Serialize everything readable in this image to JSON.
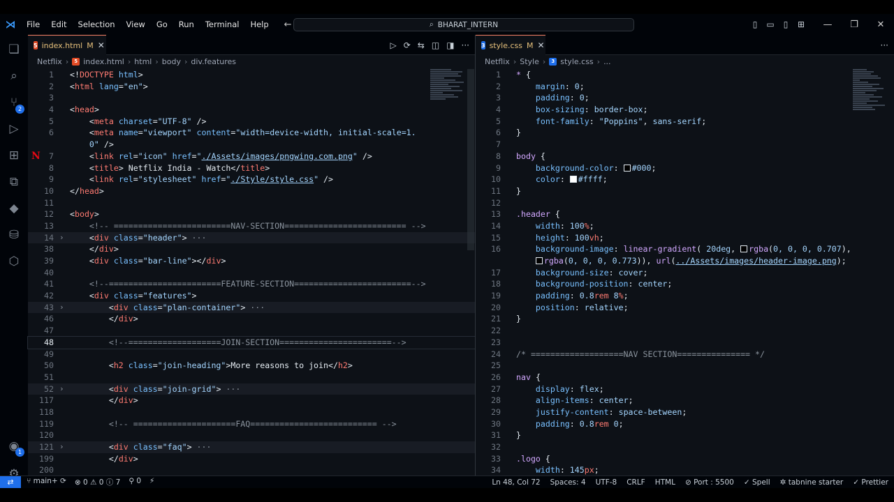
{
  "titlebar": {
    "menu": [
      "File",
      "Edit",
      "Selection",
      "View",
      "Go",
      "Run",
      "Terminal",
      "Help"
    ],
    "search": "BHARAT_INTERN"
  },
  "activity": {
    "source_control_badge": "2",
    "accounts_badge": "1"
  },
  "left": {
    "tab": {
      "name": "index.html",
      "modified": "M"
    },
    "crumbs": [
      "Netflix",
      "index.html",
      "html",
      "body",
      "div.features"
    ],
    "lines": [
      {
        "n": "1",
        "h": "<span class='p'>&lt;!</span><span class='t'>DOCTYPE</span> <span class='a'>html</span><span class='p'>&gt;</span>"
      },
      {
        "n": "2",
        "h": "<span class='p'>&lt;</span><span class='t'>html</span> <span class='a'>lang</span><span class='p'>=</span><span class='s'>\"en\"</span><span class='p'>&gt;</span>"
      },
      {
        "n": "3",
        "h": ""
      },
      {
        "n": "4",
        "h": "<span class='p'>&lt;</span><span class='t'>head</span><span class='p'>&gt;</span>"
      },
      {
        "n": "5",
        "h": "    <span class='p'>&lt;</span><span class='t'>meta</span> <span class='a'>charset</span><span class='p'>=</span><span class='s'>\"UTF-8\"</span> <span class='p'>/&gt;</span>"
      },
      {
        "n": "6",
        "h": "    <span class='p'>&lt;</span><span class='t'>meta</span> <span class='a'>name</span><span class='p'>=</span><span class='s'>\"viewport\"</span> <span class='a'>content</span><span class='p'>=</span><span class='s'>\"width=device-width, initial-scale=1.</span>"
      },
      {
        "n": "",
        "h": "    <span class='s'>0\"</span> <span class='p'>/&gt;</span>"
      },
      {
        "n": "7",
        "h": "    <span class='p'>&lt;</span><span class='t'>link</span> <span class='a'>rel</span><span class='p'>=</span><span class='s'>\"icon\"</span> <span class='a'>href</span><span class='p'>=</span><span class='s'>\"<u>./Assets/images/pngwing.com.png</u>\"</span> <span class='p'>/&gt;</span>",
        "logo": "N"
      },
      {
        "n": "8",
        "h": "    <span class='p'>&lt;</span><span class='t'>title</span><span class='p'>&gt;</span><span class='p'> Netflix India - Watch</span><span class='p'>&lt;/</span><span class='t'>title</span><span class='p'>&gt;</span>"
      },
      {
        "n": "9",
        "h": "    <span class='p'>&lt;</span><span class='t'>link</span> <span class='a'>rel</span><span class='p'>=</span><span class='s'>\"stylesheet\"</span> <span class='a'>href</span><span class='p'>=</span><span class='s'>\"<u>./Style/style.css</u>\"</span> <span class='p'>/&gt;</span>"
      },
      {
        "n": "10",
        "h": "<span class='p'>&lt;/</span><span class='t'>head</span><span class='p'>&gt;</span>"
      },
      {
        "n": "11",
        "h": ""
      },
      {
        "n": "12",
        "h": "<span class='p'>&lt;</span><span class='t'>body</span><span class='p'>&gt;</span>"
      },
      {
        "n": "13",
        "h": "    <span class='c'>&lt;!-- ========================NAV-SECTION========================= --&gt;</span>"
      },
      {
        "n": "14",
        "h": "    <span class='p'>&lt;</span><span class='t'>div</span> <span class='a'>class</span><span class='p'>=</span><span class='s'>\"header\"</span><span class='p'>&gt;</span><span class='c'> ···</span>",
        "fold": "›",
        "hl": true
      },
      {
        "n": "38",
        "h": "    <span class='p'>&lt;/</span><span class='t'>div</span><span class='p'>&gt;</span>"
      },
      {
        "n": "39",
        "h": "    <span class='p'>&lt;</span><span class='t'>div</span> <span class='a'>class</span><span class='p'>=</span><span class='s'>\"bar-line\"</span><span class='p'>&gt;&lt;/</span><span class='t'>div</span><span class='p'>&gt;</span>"
      },
      {
        "n": "40",
        "h": ""
      },
      {
        "n": "41",
        "h": "    <span class='c'>&lt;!--=======================FEATURE-SECTION========================--&gt;</span>"
      },
      {
        "n": "42",
        "h": "    <span class='p'>&lt;</span><span class='t'>div</span> <span class='a'>class</span><span class='p'>=</span><span class='s'>\"features\"</span><span class='p'>&gt;</span>"
      },
      {
        "n": "43",
        "h": "        <span class='p'>&lt;</span><span class='t'>div</span> <span class='a'>class</span><span class='p'>=</span><span class='s'>\"plan-container\"</span><span class='p'>&gt;</span><span class='c'> ···</span>",
        "fold": "›",
        "hl": true
      },
      {
        "n": "46",
        "h": "        <span class='p'>&lt;/</span><span class='t'>div</span><span class='p'>&gt;</span>"
      },
      {
        "n": "47",
        "h": ""
      },
      {
        "n": "48",
        "h": "        <span class='c'>&lt;!--===================JOIN-SECTION=======================--&gt;</span>",
        "cur": true
      },
      {
        "n": "49",
        "h": ""
      },
      {
        "n": "50",
        "h": "        <span class='p'>&lt;</span><span class='t'>h2</span> <span class='a'>class</span><span class='p'>=</span><span class='s'>\"join-heading\"</span><span class='p'>&gt;More reasons to join&lt;/</span><span class='t'>h2</span><span class='p'>&gt;</span>"
      },
      {
        "n": "51",
        "h": ""
      },
      {
        "n": "52",
        "h": "        <span class='p'>&lt;</span><span class='t'>div</span> <span class='a'>class</span><span class='p'>=</span><span class='s'>\"join-grid\"</span><span class='p'>&gt;</span><span class='c'> ···</span>",
        "fold": "›",
        "hl": true
      },
      {
        "n": "117",
        "h": "        <span class='p'>&lt;/</span><span class='t'>div</span><span class='p'>&gt;</span>"
      },
      {
        "n": "118",
        "h": ""
      },
      {
        "n": "119",
        "h": "        <span class='c'>&lt;!-- =====================FAQ========================== --&gt;</span>"
      },
      {
        "n": "120",
        "h": ""
      },
      {
        "n": "121",
        "h": "        <span class='p'>&lt;</span><span class='t'>div</span> <span class='a'>class</span><span class='p'>=</span><span class='s'>\"faq\"</span><span class='p'>&gt;</span><span class='c'> ···</span>",
        "fold": "›",
        "hl": true
      },
      {
        "n": "199",
        "h": "        <span class='p'>&lt;/</span><span class='t'>div</span><span class='p'>&gt;</span>"
      },
      {
        "n": "200",
        "h": ""
      }
    ]
  },
  "right": {
    "tab": {
      "name": "style.css",
      "modified": "M"
    },
    "crumbs": [
      "Netflix",
      "Style",
      "style.css",
      "..."
    ],
    "lines": [
      {
        "n": "1",
        "h": "<span class='sel'>*</span> <span class='p'>{</span>"
      },
      {
        "n": "2",
        "h": "    <span class='prop'>margin</span><span class='p'>: </span><span class='val'>0</span><span class='p'>;</span>"
      },
      {
        "n": "3",
        "h": "    <span class='prop'>padding</span><span class='p'>: </span><span class='val'>0</span><span class='p'>;</span>"
      },
      {
        "n": "4",
        "h": "    <span class='prop'>box-sizing</span><span class='p'>: </span><span class='val'>border-box</span><span class='p'>;</span>"
      },
      {
        "n": "5",
        "h": "    <span class='prop'>font-family</span><span class='p'>: </span><span class='s'>\"Poppins\"</span><span class='p'>, </span><span class='val'>sans-serif</span><span class='p'>;</span>"
      },
      {
        "n": "6",
        "h": "<span class='p'>}</span>"
      },
      {
        "n": "7",
        "h": ""
      },
      {
        "n": "8",
        "h": "<span class='sel'>body</span> <span class='p'>{</span>"
      },
      {
        "n": "9",
        "h": "    <span class='prop'>background-color</span><span class='p'>: </span><span class='sw' style='background:#000'></span><span class='val'>#000</span><span class='p'>;</span>"
      },
      {
        "n": "10",
        "h": "    <span class='prop'>color</span><span class='p'>: </span><span class='sw' style='background:#fff'></span><span class='val'>#ffff</span><span class='p'>;</span>"
      },
      {
        "n": "11",
        "h": "<span class='p'>}</span>"
      },
      {
        "n": "12",
        "h": ""
      },
      {
        "n": "13",
        "h": "<span class='sel'>.header</span> <span class='p'>{</span>"
      },
      {
        "n": "14",
        "h": "    <span class='prop'>width</span><span class='p'>: </span><span class='val'>100</span><span class='u'>%</span><span class='p'>;</span>"
      },
      {
        "n": "15",
        "h": "    <span class='prop'>height</span><span class='p'>: </span><span class='val'>100</span><span class='u'>vh</span><span class='p'>;</span>"
      },
      {
        "n": "16",
        "h": "    <span class='prop'>background-image</span><span class='p'>: </span><span class='sel'>linear-gradient</span><span class='p'>( </span><span class='val'>20deg</span><span class='p'>, </span><span class='sw' style='background:#000'></span><span class='sel'>rgba</span><span class='p'>(</span><span class='val'>0, 0, 0, 0.707</span><span class='p'>),</span>"
      },
      {
        "n": "",
        "h": "    <span class='sw' style='background:#000'></span><span class='sel'>rgba</span><span class='p'>(</span><span class='val'>0, 0, 0, 0.773</span><span class='p'>)), </span><span class='sel'>url</span><span class='p'>(</span><span class='s'><u>../Assets/images/header-image.png</u></span><span class='p'>);</span>"
      },
      {
        "n": "17",
        "h": "    <span class='prop'>background-size</span><span class='p'>: </span><span class='val'>cover</span><span class='p'>;</span>"
      },
      {
        "n": "18",
        "h": "    <span class='prop'>background-position</span><span class='p'>: </span><span class='val'>center</span><span class='p'>;</span>"
      },
      {
        "n": "19",
        "h": "    <span class='prop'>padding</span><span class='p'>: </span><span class='val'>0.8</span><span class='u'>rem</span> <span class='val'>8</span><span class='u'>%</span><span class='p'>;</span>"
      },
      {
        "n": "20",
        "h": "    <span class='prop'>position</span><span class='p'>: </span><span class='val'>relative</span><span class='p'>;</span>"
      },
      {
        "n": "21",
        "h": "<span class='p'>}</span>"
      },
      {
        "n": "22",
        "h": ""
      },
      {
        "n": "23",
        "h": ""
      },
      {
        "n": "24",
        "h": "<span class='c'>/* ===================NAV SECTION=============== */</span>"
      },
      {
        "n": "25",
        "h": ""
      },
      {
        "n": "26",
        "h": "<span class='sel'>nav</span> <span class='p'>{</span>"
      },
      {
        "n": "27",
        "h": "    <span class='prop'>display</span><span class='p'>: </span><span class='val'>flex</span><span class='p'>;</span>"
      },
      {
        "n": "28",
        "h": "    <span class='prop'>align-items</span><span class='p'>: </span><span class='val'>center</span><span class='p'>;</span>"
      },
      {
        "n": "29",
        "h": "    <span class='prop'>justify-content</span><span class='p'>: </span><span class='val'>space-between</span><span class='p'>;</span>"
      },
      {
        "n": "30",
        "h": "    <span class='prop'>padding</span><span class='p'>: </span><span class='val'>0.8</span><span class='u'>rem</span> <span class='val'>0</span><span class='p'>;</span>"
      },
      {
        "n": "31",
        "h": "<span class='p'>}</span>"
      },
      {
        "n": "32",
        "h": ""
      },
      {
        "n": "33",
        "h": "<span class='sel'>.logo</span> <span class='p'>{</span>"
      },
      {
        "n": "34",
        "h": "    <span class='prop'>width</span><span class='p'>: </span><span class='val'>145</span><span class='u'>px</span><span class='p'>;</span>"
      }
    ]
  },
  "status": {
    "branch": "main+",
    "errors": "0",
    "warnings": "0",
    "info": "7",
    "ports": "0",
    "cursor": "Ln 48, Col 72",
    "spaces": "Spaces: 4",
    "encoding": "UTF-8",
    "eol": "CRLF",
    "language": "HTML",
    "port": "Port : 5500",
    "spell": "Spell",
    "tabnine": "tabnine starter",
    "prettier": "Prettier"
  }
}
